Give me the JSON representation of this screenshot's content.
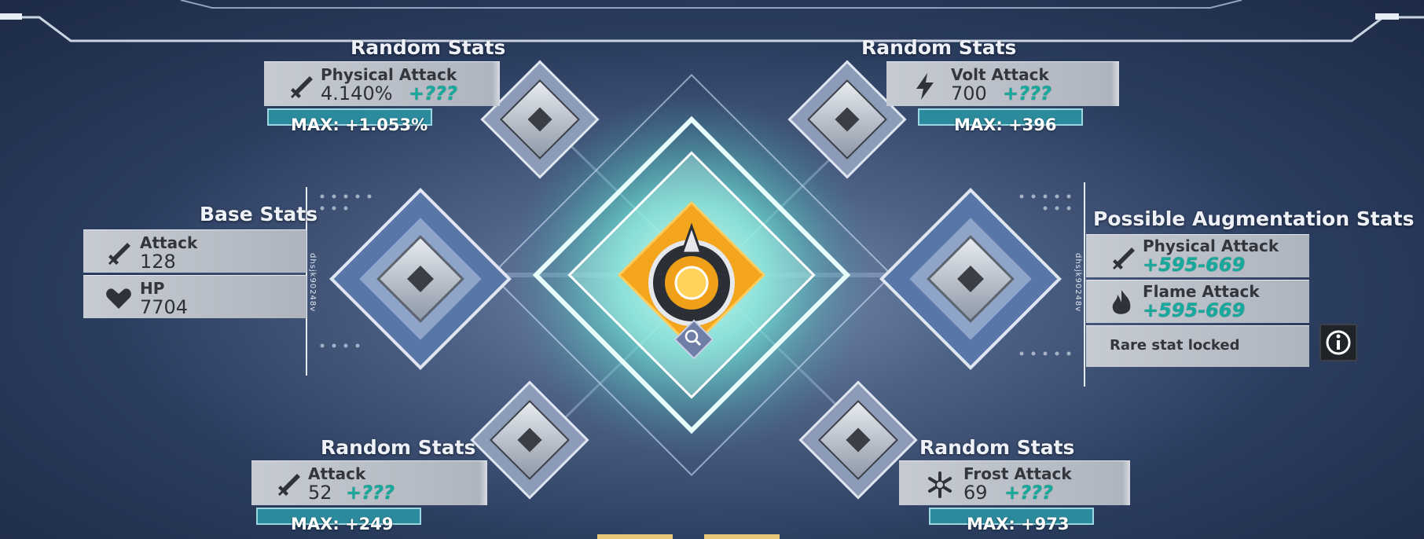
{
  "top_left": {
    "title": "Random Stats",
    "name": "Physical Attack",
    "value": "4.140%",
    "aug": "+???",
    "max_label": "MAX:",
    "max_value": "+1.053%",
    "icon": "sword-icon"
  },
  "top_right": {
    "title": "Random Stats",
    "name": "Volt Attack",
    "value": "700",
    "aug": "+???",
    "max_label": "MAX:",
    "max_value": "+396",
    "icon": "lightning-icon"
  },
  "bottom_left": {
    "title": "Random Stats",
    "name": "Attack",
    "value": "52",
    "aug": "+???",
    "max_label": "MAX:",
    "max_value": "+249",
    "icon": "sword-icon"
  },
  "bottom_right": {
    "title": "Random Stats",
    "name": "Frost Attack",
    "value": "69",
    "aug": "+???",
    "max_label": "MAX:",
    "max_value": "+973",
    "icon": "snowflake-icon"
  },
  "base_stats": {
    "title": "Base Stats",
    "items": [
      {
        "name": "Attack",
        "value": "128",
        "icon": "sword-icon"
      },
      {
        "name": "HP",
        "value": "7704",
        "icon": "heart-icon"
      }
    ]
  },
  "augmentation": {
    "title": "Possible Augmentation Stats",
    "items": [
      {
        "name": "Physical Attack",
        "value": "+595-669",
        "icon": "sword-icon"
      },
      {
        "name": "Flame Attack",
        "value": "+595-669",
        "icon": "flame-icon"
      }
    ],
    "locked_text": "Rare stat locked",
    "info_icon": "info-icon"
  },
  "side_code_left": "dhsjk90248v",
  "side_code_right": "dhsjk90248v",
  "colors": {
    "accent_teal": "#17a99c",
    "max_bar": "#2b8a9c",
    "core_orange": "#f2a51d",
    "glow": "#62f0d8"
  }
}
